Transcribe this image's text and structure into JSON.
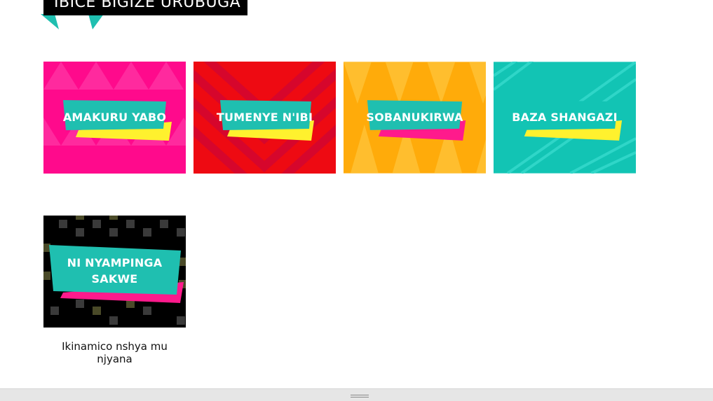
{
  "header": {
    "title": "IBICE BIGIZE URUBUGA"
  },
  "tiles": [
    {
      "label": "AMAKURU YABO",
      "color": "#ff0a8c",
      "accent": "#fff12e",
      "label_bg": "#1fbfb0"
    },
    {
      "label": "TUMENYE N'IBI",
      "color": "#ee0a12",
      "accent": "#fff12e",
      "label_bg": "#1fbfb0"
    },
    {
      "label": "SOBANUKIRWA",
      "color": "#ffab0a",
      "accent": "#ff1a8c",
      "label_bg": "#1fbfb0"
    },
    {
      "label": "BAZA SHANGAZI",
      "color": "#12c4b4",
      "accent": "#fff12e",
      "label_bg": "#12c4b4"
    }
  ],
  "featured": {
    "label_line1": "NI NYAMPINGA",
    "label_line2": "SAKWE",
    "caption": "Ikinamico nshya mu njyana",
    "color": "#000000",
    "accent": "#ff1a8c",
    "label_bg": "#1fbfb0"
  }
}
